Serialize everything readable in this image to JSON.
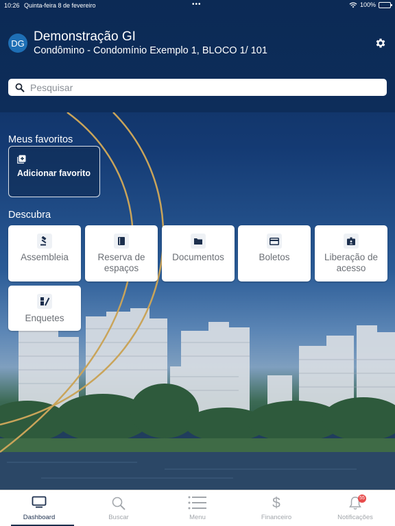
{
  "status_bar": {
    "time": "10:26",
    "date": "Quinta-feira 8 de fevereiro",
    "battery": "100%"
  },
  "user": {
    "initials": "DG",
    "name": "Demonstração GI",
    "subtitle": "Condômino - Condomínio Exemplo 1, BLOCO 1/ 101"
  },
  "search": {
    "placeholder": "Pesquisar"
  },
  "favorites": {
    "title": "Meus favoritos",
    "add_label": "Adicionar favorito"
  },
  "discover": {
    "title": "Descubra",
    "items": [
      {
        "label": "Assembleia",
        "icon": "gavel-icon"
      },
      {
        "label": "Reserva de espaços",
        "icon": "book-icon"
      },
      {
        "label": "Documentos",
        "icon": "folder-icon"
      },
      {
        "label": "Boletos",
        "icon": "card-icon"
      },
      {
        "label": "Liberação de acesso",
        "icon": "id-badge-icon"
      },
      {
        "label": "Enquetes",
        "icon": "poll-icon"
      }
    ]
  },
  "tabs": [
    {
      "label": "Dashboard",
      "icon": "monitor-icon",
      "active": true
    },
    {
      "label": "Buscar",
      "icon": "search-icon",
      "active": false
    },
    {
      "label": "Menu",
      "icon": "menu-icon",
      "active": false
    },
    {
      "label": "Financeiro",
      "icon": "dollar-icon",
      "active": false
    },
    {
      "label": "Notificações",
      "icon": "bell-icon",
      "active": false,
      "badge": "55"
    }
  ],
  "colors": {
    "header": "#0c2a55",
    "accent": "#1c2f4d",
    "avatar": "#1e6fb5",
    "badge": "#e74c4c",
    "gold_arc": "#c9a45a"
  }
}
